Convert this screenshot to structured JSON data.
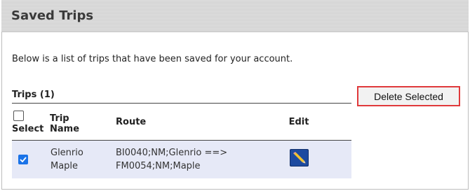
{
  "header": {
    "title": "Saved Trips"
  },
  "intro_text": "Below is a list of trips that have been saved for your account.",
  "trips_label": "Trips (1)",
  "delete_button": "Delete Selected",
  "table": {
    "columns": {
      "select": "Select",
      "name_line1": "Trip",
      "name_line2": "Name",
      "route": "Route",
      "edit": "Edit"
    },
    "rows": [
      {
        "selected": true,
        "name_line1": "Glenrio",
        "name_line2": "Maple",
        "route_line1": "BI0040;NM;Glenrio ==>",
        "route_line2": "FM0054;NM;Maple",
        "edit_icon": "pencil-icon"
      }
    ]
  },
  "colors": {
    "accent_checkbox": "#1a73e8",
    "highlight_border": "#e0393b",
    "row_background": "#e6e9f7"
  }
}
